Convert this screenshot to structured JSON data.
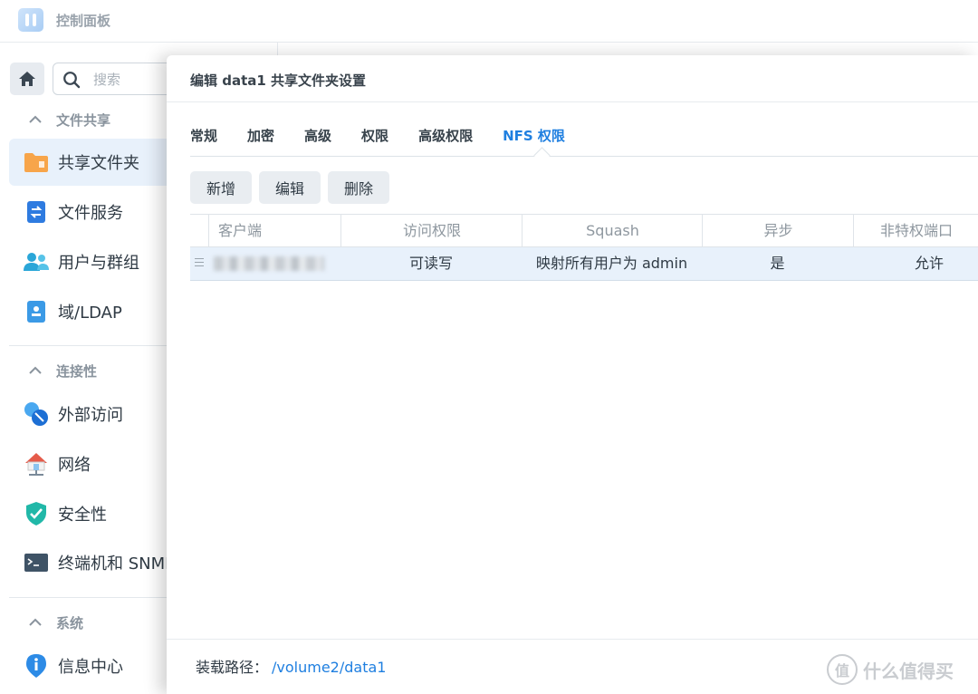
{
  "app": {
    "title": "控制面板"
  },
  "search": {
    "placeholder": "搜索"
  },
  "sidebar": {
    "sections": [
      {
        "label": "文件共享"
      },
      {
        "label": "连接性"
      },
      {
        "label": "系统"
      }
    ],
    "items": [
      {
        "label": "共享文件夹",
        "icon": "folder-icon"
      },
      {
        "label": "文件服务",
        "icon": "file-services-icon"
      },
      {
        "label": "用户与群组",
        "icon": "users-icon"
      },
      {
        "label": "域/LDAP",
        "icon": "ldap-icon"
      },
      {
        "label": "外部访问",
        "icon": "external-access-icon"
      },
      {
        "label": "网络",
        "icon": "network-icon"
      },
      {
        "label": "安全性",
        "icon": "shield-icon"
      },
      {
        "label": "终端机和 SNMP",
        "icon": "terminal-icon"
      },
      {
        "label": "信息中心",
        "icon": "info-icon"
      }
    ],
    "active_item": "共享文件夹"
  },
  "dialog": {
    "title": "编辑 data1 共享文件夹设置",
    "tabs": [
      {
        "label": "常规"
      },
      {
        "label": "加密"
      },
      {
        "label": "高级"
      },
      {
        "label": "权限"
      },
      {
        "label": "高级权限"
      },
      {
        "label": "NFS 权限"
      }
    ],
    "active_tab": "NFS 权限",
    "toolbar": {
      "add": "新增",
      "edit": "编辑",
      "delete": "删除"
    },
    "table": {
      "columns": [
        "客户端",
        "访问权限",
        "Squash",
        "异步",
        "非特权端口"
      ],
      "rows": [
        {
          "client": "",
          "access": "可读写",
          "squash": "映射所有用户为 admin",
          "async": "是",
          "nonpriv": "允许"
        }
      ]
    },
    "mount_label": "装载路径：",
    "mount_path": "/volume2/data1"
  },
  "watermark": {
    "text": "什么值得买",
    "badge": "值"
  },
  "colors": {
    "accent": "#1f7fe0",
    "selected_row": "#e8f1fb",
    "active_sidebar": "#e8f1fb"
  }
}
